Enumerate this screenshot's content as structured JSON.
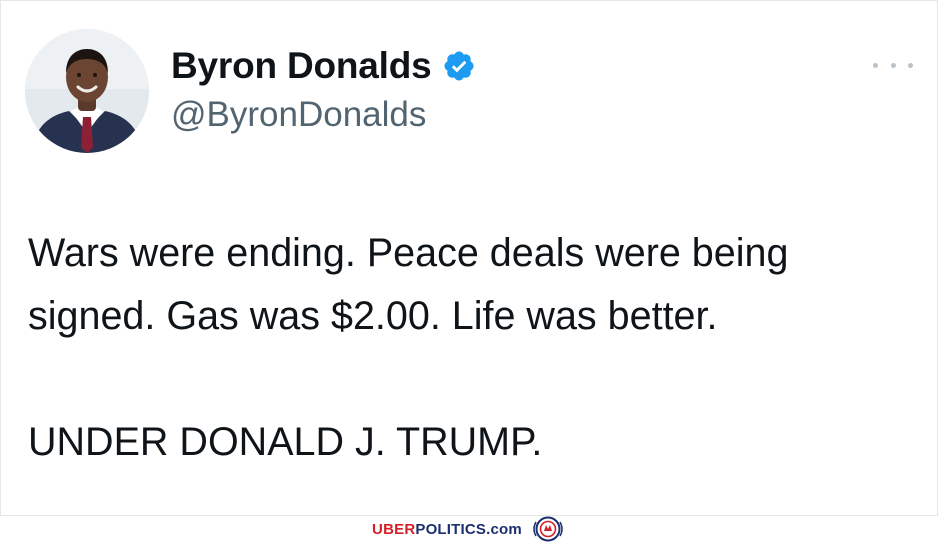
{
  "tweet": {
    "author": {
      "display_name": "Byron Donalds",
      "handle": "@ByronDonalds",
      "verified": true,
      "verified_color": "#1d9bf0"
    },
    "menu_icon": "more-horizontal-icon",
    "text": {
      "line1": "Wars were ending. Peace deals were being",
      "line2": "signed. Gas was $2.00. Life was better.",
      "line3": "UNDER DONALD J. TRUMP."
    }
  },
  "watermark": {
    "part1": "UBER",
    "part2": "POLITICS.com",
    "part1_color": "#d42027",
    "part2_color": "#1b2f6e"
  }
}
